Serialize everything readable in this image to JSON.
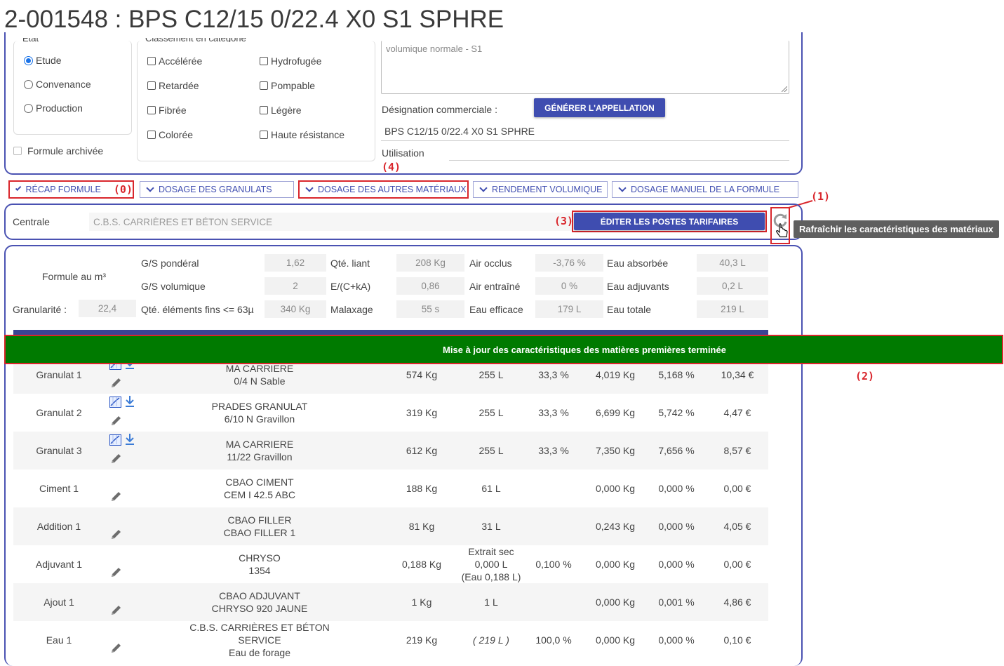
{
  "page_title": "2-001548 : BPS C12/15 0/22.4 X0 S1 SPHRE",
  "etat": {
    "legend": "Etat",
    "options": [
      "Etude",
      "Convenance",
      "Production"
    ],
    "selected": "Etude"
  },
  "archive_label": "Formule archivée",
  "classement": {
    "legend": "Classement en catégorie",
    "col1": [
      "Accélérée",
      "Retardée",
      "Fibrée",
      "Colorée"
    ],
    "col2": [
      "Hydrofugée",
      "Pompable",
      "Légère",
      "Haute résistance"
    ]
  },
  "appellation_text": "volumique normale - S1",
  "designation_label": "Désignation commerciale :",
  "generate_button": "GÉNÉRER L'APPELLATION",
  "designation_value": "BPS C12/15 0/22.4 X0 S1 SPHRE",
  "utilisation_label": "Utilisation",
  "tabs": [
    "RÉCAP FORMULE",
    "DOSAGE DES GRANULATS",
    "DOSAGE DES AUTRES MATÉRIAUX",
    "RENDEMENT VOLUMIQUE",
    "DOSAGE MANUEL DE LA FORMULE"
  ],
  "annotations": {
    "a0": "(0)",
    "a1": "(1)",
    "a2": "(2)",
    "a3": "(3)",
    "a4": "(4)"
  },
  "centrale": {
    "label": "Centrale",
    "value": "C.B.S. CARRIÈRES ET BÉTON SERVICE",
    "edit_button": "ÉDITER LES POSTES TARIFAIRES"
  },
  "refresh_tooltip": "Rafraîchir les caractéristiques des matériaux",
  "formula": {
    "label": "Formule au m³",
    "granularite_label": "Granularité :",
    "granularite_value": "22,4",
    "stats": [
      {
        "label": "G/S pondéral",
        "value": "1,62"
      },
      {
        "label": "G/S volumique",
        "value": "2"
      },
      {
        "label": "Qté. éléments fins <= 63µ",
        "value": "340 Kg"
      },
      {
        "label": "Qté. liant",
        "value": "208 Kg"
      },
      {
        "label": "E/(C+kA)",
        "value": "0,86"
      },
      {
        "label": "Malaxage",
        "value": "55 s"
      },
      {
        "label": "Air occlus",
        "value": "-3,76 %"
      },
      {
        "label": "Air entraîné",
        "value": "0 %"
      },
      {
        "label": "Eau efficace",
        "value": "179 L"
      },
      {
        "label": "Eau absorbée",
        "value": "40,3 L"
      },
      {
        "label": "Eau adjuvants",
        "value": "0,2 L"
      },
      {
        "label": "Eau totale",
        "value": "219 L"
      }
    ]
  },
  "banner": "Mise à jour des caractéristiques des matières premières terminée",
  "rows": [
    {
      "name": "Granulat 1",
      "supplier": "MA CARRIERE",
      "product": "0/4 N Sable",
      "mass": "574 Kg",
      "vol": "255 L",
      "vol_extra": "",
      "pct": "33,3 %",
      "col6": "4,019 Kg",
      "col7": "5,168 %",
      "price": "10,34 €",
      "chart": true
    },
    {
      "name": "Granulat 2",
      "supplier": "PRADES GRANULAT",
      "product": "6/10 N Gravillon",
      "mass": "319 Kg",
      "vol": "255 L",
      "vol_extra": "",
      "pct": "33,3 %",
      "col6": "6,699 Kg",
      "col7": "5,742 %",
      "price": "4,47 €",
      "chart": true
    },
    {
      "name": "Granulat 3",
      "supplier": "MA CARRIERE",
      "product": "11/22 Gravillon",
      "mass": "612 Kg",
      "vol": "255 L",
      "vol_extra": "",
      "pct": "33,3 %",
      "col6": "7,350 Kg",
      "col7": "7,656 %",
      "price": "8,57 €",
      "chart": true
    },
    {
      "name": "Ciment 1",
      "supplier": "CBAO CIMENT",
      "product": "CEM I 42.5 ABC",
      "mass": "188 Kg",
      "vol": "61 L",
      "vol_extra": "",
      "pct": "",
      "col6": "0,000 Kg",
      "col7": "0,000 %",
      "price": "0,00 €",
      "chart": false
    },
    {
      "name": "Addition 1",
      "supplier": "CBAO FILLER",
      "product": "CBAO FILLER 1",
      "mass": "81 Kg",
      "vol": "31 L",
      "vol_extra": "",
      "pct": "",
      "col6": "0,243 Kg",
      "col7": "0,000 %",
      "price": "4,05 €",
      "chart": false
    },
    {
      "name": "Adjuvant 1",
      "supplier": "CHRYSO",
      "product": "1354",
      "mass": "0,188 Kg",
      "vol": "Extrait sec",
      "vol_extra": "0,000 L",
      "vol_extra2": "(Eau 0,188 L)",
      "pct": "0,100 %",
      "col6": "0,000 Kg",
      "col7": "0,000 %",
      "price": "0,00 €",
      "chart": false
    },
    {
      "name": "Ajout 1",
      "supplier": "CBAO ADJUVANT",
      "product": "CHRYSO 920 JAUNE",
      "mass": "1 Kg",
      "vol": "1 L",
      "vol_extra": "",
      "pct": "",
      "col6": "0,000 Kg",
      "col7": "0,001 %",
      "price": "4,86 €",
      "chart": false
    },
    {
      "name": "Eau 1",
      "supplier": "C.B.S. CARRIÈRES ET BÉTON SERVICE",
      "product": "Eau de forage",
      "mass": "219 Kg",
      "vol": "( 219 L )",
      "vol_extra": "",
      "pct": "100,0 %",
      "col6": "0,000 Kg",
      "col7": "0,000 %",
      "price": "0,10 €",
      "chart": false
    }
  ]
}
